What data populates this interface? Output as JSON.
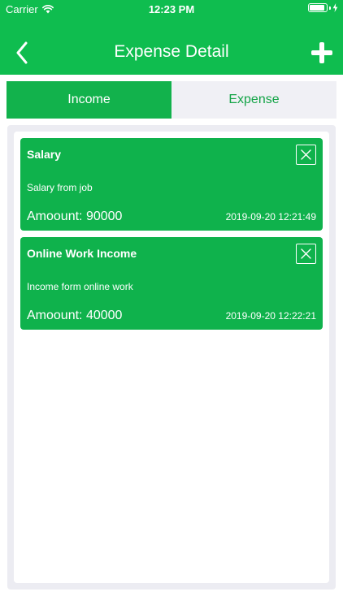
{
  "status_bar": {
    "carrier": "Carrier",
    "time": "12:23 PM",
    "battery_level": 0.9
  },
  "header": {
    "title": "Expense Detail",
    "back_icon": "chevron-left-icon",
    "add_icon": "plus-icon"
  },
  "tabs": [
    {
      "label": "Income",
      "active": true
    },
    {
      "label": "Expense",
      "active": false
    }
  ],
  "entries": [
    {
      "title": "Salary",
      "description": "Salary from job",
      "amount_label": "Amoount:",
      "amount": "90000",
      "datetime": "2019-09-20 12:21:49"
    },
    {
      "title": "Online Work Income",
      "description": "Income form online work",
      "amount_label": "Amoount:",
      "amount": "40000",
      "datetime": "2019-09-20 12:22:21"
    }
  ],
  "colors": {
    "primary": "#0fbd4f",
    "card": "#0fb24c",
    "tab_active": "#12b24c",
    "tab_inactive_bg": "#f0f0f5",
    "tab_inactive_text": "#14a447",
    "panel_bg": "#ececf2"
  }
}
